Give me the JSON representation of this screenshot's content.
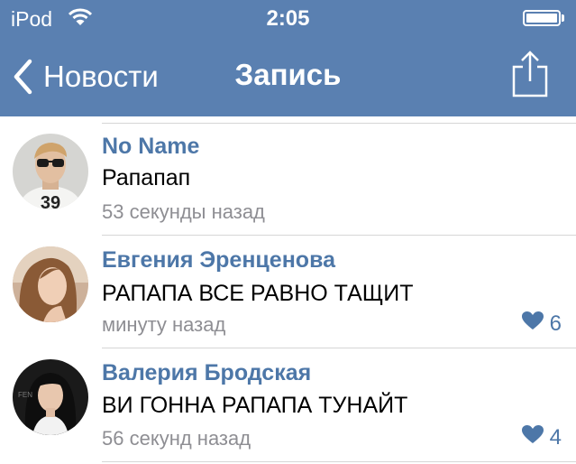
{
  "status_bar": {
    "carrier": "iPod",
    "time": "2:05"
  },
  "nav": {
    "back_label": "Новости",
    "title": "Запись"
  },
  "comments": [
    {
      "name": "No Name",
      "text": "Рапапап",
      "time": "53 секунды назад",
      "likes": ""
    },
    {
      "name": "Евгения Эренценова",
      "text": "РАПАПА ВСЕ РАВНО ТАЩИТ",
      "time": "минуту назад",
      "likes": "6"
    },
    {
      "name": "Валерия Бродская",
      "text": "ВИ ГОННА РАПАПА ТУНАЙТ",
      "time": "56 секунд назад",
      "likes": "4"
    }
  ],
  "colors": {
    "bar": "#5a80b1",
    "accent": "#4d77a8",
    "muted": "#8e8e93"
  },
  "icons": [
    "wifi-icon",
    "battery-icon",
    "chevron-left-icon",
    "share-icon",
    "heart-icon"
  ]
}
